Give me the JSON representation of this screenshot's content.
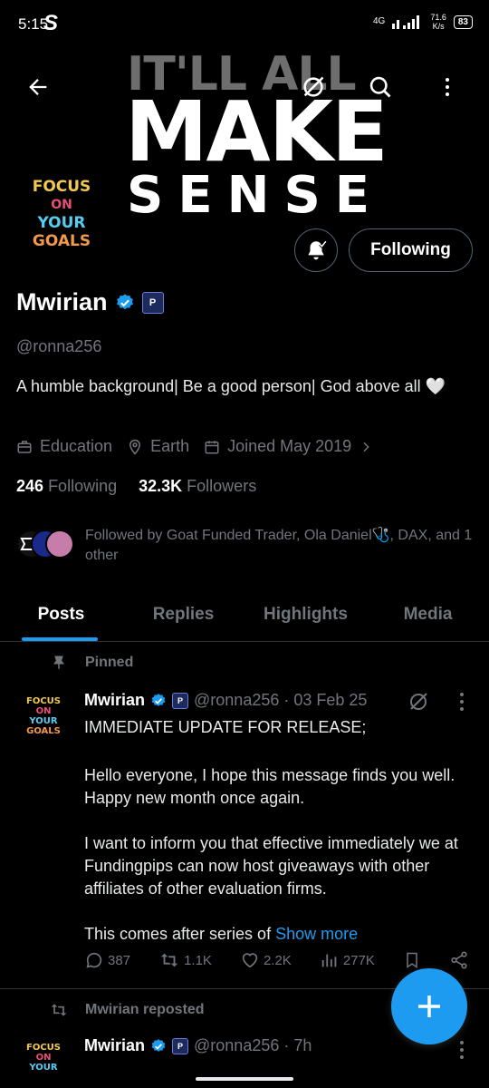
{
  "status_bar": {
    "time": "5:15",
    "app_glyph": "S",
    "network": "4G",
    "speed_value": "71.6",
    "speed_unit": "K/s",
    "battery": "83"
  },
  "banner": {
    "line1": "IT'LL ALL",
    "line2": "MAKE",
    "line3": "SENSE"
  },
  "avatar": {
    "line1": "FOCUS",
    "line2": "ON",
    "line3": "YOUR",
    "line4": "GOALS"
  },
  "profile": {
    "name": "Mwirian",
    "affiliate_glyph": "P",
    "handle": "@ronna256",
    "bio": "A humble background| Be a good person| God above all 🤍",
    "category": "Education",
    "location": "Earth",
    "joined": "Joined May 2019",
    "following_count": "246",
    "following_label": "Following",
    "followers_count": "32.3K",
    "followers_label": "Followers",
    "followed_by": "Followed by Goat Funded Trader, Ola Daniel🩺, DAX, and 1 other",
    "follow_button": "Following"
  },
  "tabs": [
    "Posts",
    "Replies",
    "Highlights",
    "Media"
  ],
  "pinned_label": "Pinned",
  "pinned_post": {
    "name": "Mwirian",
    "handle": "@ronna256 · 03 Feb 25",
    "paragraphs": [
      "IMMEDIATE UPDATE FOR RELEASE;",
      "Hello everyone, I hope this message finds you well. Happy new month once again.",
      "I want to inform you that effective immediately we at Fundingpips can now host giveaways with other affiliates of other evaluation firms."
    ],
    "last_line": "This comes after series of",
    "show_more": "Show more",
    "replies": "387",
    "reposts": "1.1K",
    "likes": "2.2K",
    "views": "277K"
  },
  "repost_label": "Mwirian reposted",
  "second_post": {
    "name": "Mwirian",
    "handle": "@ronna256 · 7h"
  },
  "colors": {
    "accent": "#1d9bf0",
    "background": "#000000",
    "muted": "#71767b"
  }
}
